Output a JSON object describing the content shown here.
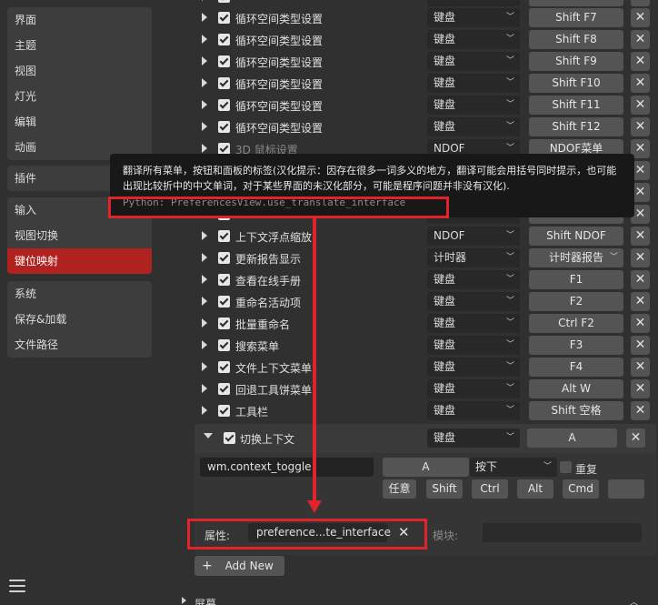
{
  "sidebar": {
    "group1": [
      "界面",
      "主题",
      "视图",
      "灯光",
      "编辑",
      "动画"
    ],
    "group2": [
      "插件"
    ],
    "group3": [
      "输入",
      "视图切换",
      "键位映射"
    ],
    "group4": [
      "系统",
      "保存&加载",
      "文件路径"
    ],
    "active": "键位映射"
  },
  "rows": [
    {
      "name": "循环空间类型设置",
      "device": "键盘",
      "key": "Shift F7"
    },
    {
      "name": "循环空间类型设置",
      "device": "键盘",
      "key": "Shift F8"
    },
    {
      "name": "循环空间类型设置",
      "device": "键盘",
      "key": "Shift F9"
    },
    {
      "name": "循环空间类型设置",
      "device": "键盘",
      "key": "Shift F10"
    },
    {
      "name": "循环空间类型设置",
      "device": "键盘",
      "key": "Shift F11"
    },
    {
      "name": "循环空间类型设置",
      "device": "键盘",
      "key": "Shift F12"
    },
    {
      "name": "3D 鼠标设置",
      "device": "NDOF",
      "key": "NDOF菜单"
    },
    {
      "name": "上下文浮点缩放",
      "device": "NDOF",
      "key": "Shift NDOF Minus"
    },
    {
      "name": "更新报告显示",
      "device": "计时器",
      "key": "计时器报告"
    },
    {
      "name": "查看在线手册",
      "device": "键盘",
      "key": "F1"
    },
    {
      "name": "重命名活动项",
      "device": "键盘",
      "key": "F2"
    },
    {
      "name": "批量重命名",
      "device": "键盘",
      "key": "Ctrl F2"
    },
    {
      "name": "搜索菜单",
      "device": "键盘",
      "key": "F3"
    },
    {
      "name": "文件上下文菜单",
      "device": "键盘",
      "key": "F4"
    },
    {
      "name": "回退工具饼菜单",
      "device": "键盘",
      "key": "Alt W"
    },
    {
      "name": "工具栏",
      "device": "键盘",
      "key": "Shift 空格"
    }
  ],
  "expanded": {
    "name": "切换上下文",
    "device": "键盘",
    "key": "A",
    "operator": "wm.context_toggle",
    "key2": "A",
    "event": "按下",
    "repeat_label": "重复",
    "modifiers": [
      "任意",
      "Shift",
      "Ctrl",
      "Alt",
      "Cmd"
    ],
    "property_label": "属性:",
    "property_value": "preference...te_interface",
    "module_label": "模块:"
  },
  "add_new_label": "Add New",
  "tooltip": {
    "text": "翻译所有菜单，按钮和面板的标签(汉化提示：因存在很多一词多义的地方，翻译可能会用括号同时提示，也可能出现比较折中的中文单词，对于某些界面的未汉化部分，可能是程序问题并非没有汉化).",
    "python": "Python: PreferencesView.use_translate_interface"
  },
  "bottom_section_label": "屏幕",
  "colors": {
    "active": "#b0221f",
    "annotation": "#e0242a"
  }
}
